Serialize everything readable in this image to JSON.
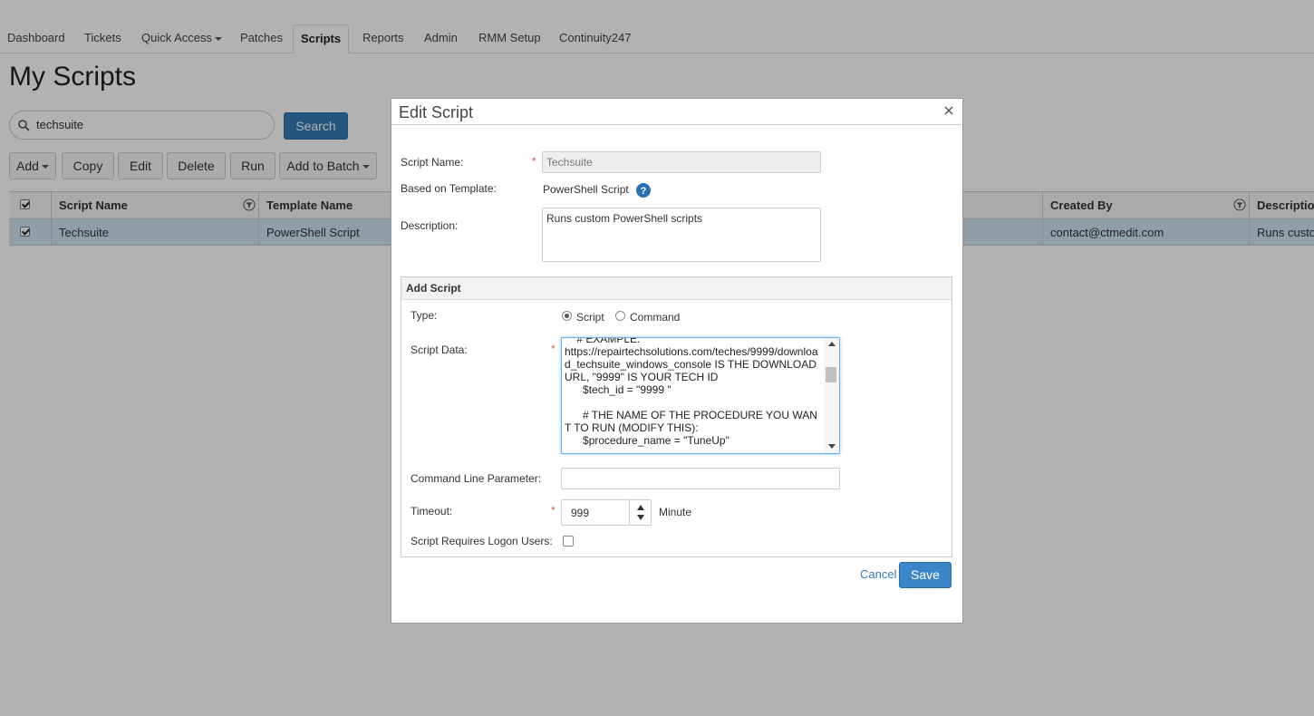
{
  "nav": {
    "items": [
      "Dashboard",
      "Tickets",
      "Quick Access",
      "Patches",
      "Scripts",
      "Reports",
      "Admin",
      "RMM Setup",
      "Continuity247"
    ],
    "active": "Scripts"
  },
  "page": {
    "title": "My Scripts"
  },
  "search": {
    "value": "techsuite",
    "button": "Search"
  },
  "toolbar": {
    "add": "Add",
    "copy": "Copy",
    "edit": "Edit",
    "delete": "Delete",
    "run": "Run",
    "add_to_batch": "Add to Batch"
  },
  "grid": {
    "columns": {
      "script_name": "Script Name",
      "template_name": "Template Name",
      "created_by": "Created By",
      "description": "Description"
    },
    "rows": [
      {
        "script_name": "Techsuite",
        "template_name": "PowerShell Script",
        "created_by": "contact@ctmedit.com",
        "description": "Runs custom PowerShell scripts"
      }
    ]
  },
  "modal": {
    "title": "Edit Script",
    "script_name_label": "Script Name:",
    "script_name_value": "Techsuite",
    "template_label": "Based on Template:",
    "template_value": "PowerShell Script",
    "description_label": "Description:",
    "description_value": "Runs custom PowerShell scripts",
    "section_title": "Add Script",
    "type_label": "Type:",
    "type_options": [
      "Script",
      "Command"
    ],
    "type_selected": "Script",
    "script_data_label": "Script Data:",
    "script_data_value": "    # EXAMPLE:\nhttps://repairtechsolutions.com/teches/9999/download_techsuite_windows_console IS THE DOWNLOAD URL, \"9999\" IS YOUR TECH ID\n      $tech_id = \"9999 \"\n\n      # THE NAME OF THE PROCEDURE YOU WANT TO RUN (MODIFY THIS):\n      $procedure_name = \"TuneUp\"",
    "command_line_label": "Command Line Parameter:",
    "command_line_value": "",
    "timeout_label": "Timeout:",
    "timeout_value": "999",
    "timeout_unit": "Minute",
    "logon_label": "Script Requires Logon Users:",
    "logon_checked": false,
    "cancel": "Cancel",
    "save": "Save"
  }
}
